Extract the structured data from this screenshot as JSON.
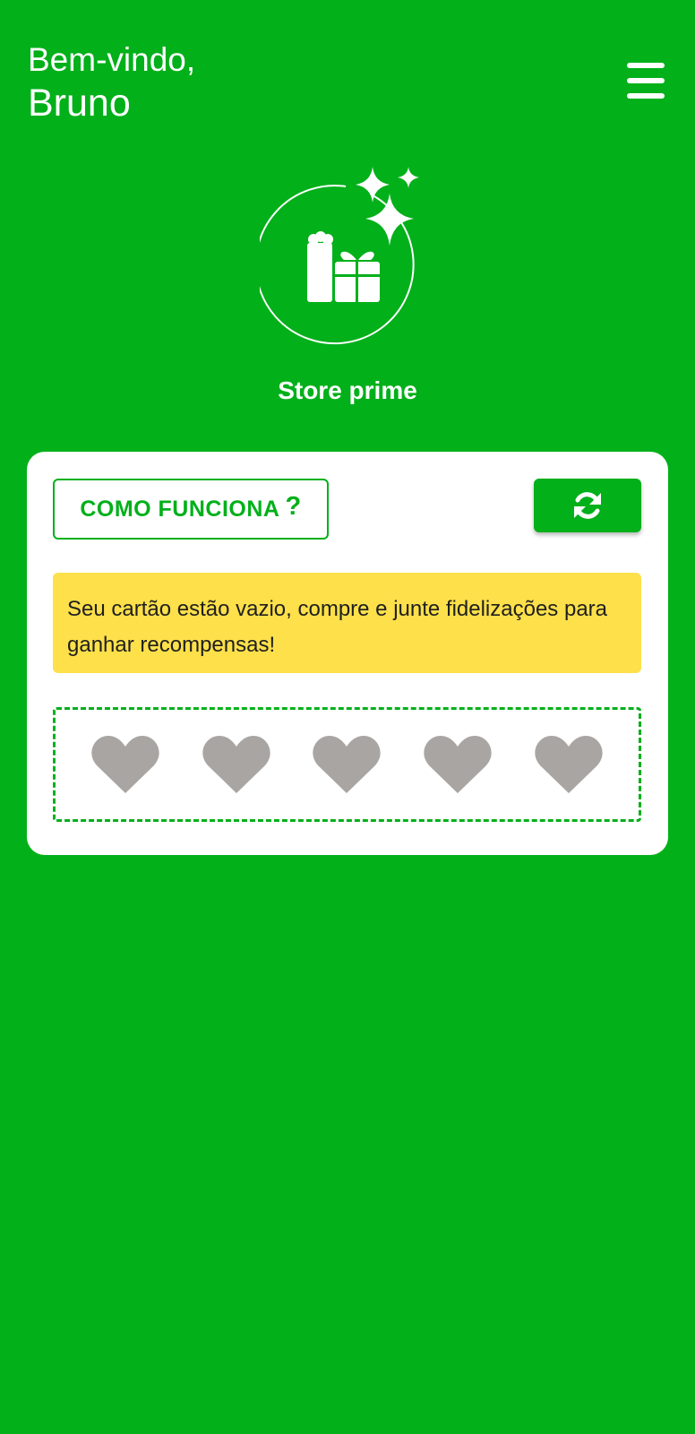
{
  "header": {
    "greeting": "Bem-vindo,",
    "username": "Bruno"
  },
  "store": {
    "name": "Store prime",
    "logo_icon": "gift-sparkle-icon"
  },
  "card": {
    "how_it_works_label": "COMO FUNCIONA",
    "how_it_works_suffix": "?",
    "refresh_icon": "refresh-icon",
    "empty_message": "Seu cartão estão vazio, compre e junte fidelizações para ganhar recompensas!",
    "stamps_filled": 0,
    "stamps_total": 5,
    "stamp_icon": "heart-icon"
  },
  "colors": {
    "primary": "#02b01a",
    "notice_bg": "#fde04a",
    "stamp_empty": "#a8a5a3",
    "card_bg": "#ffffff"
  }
}
